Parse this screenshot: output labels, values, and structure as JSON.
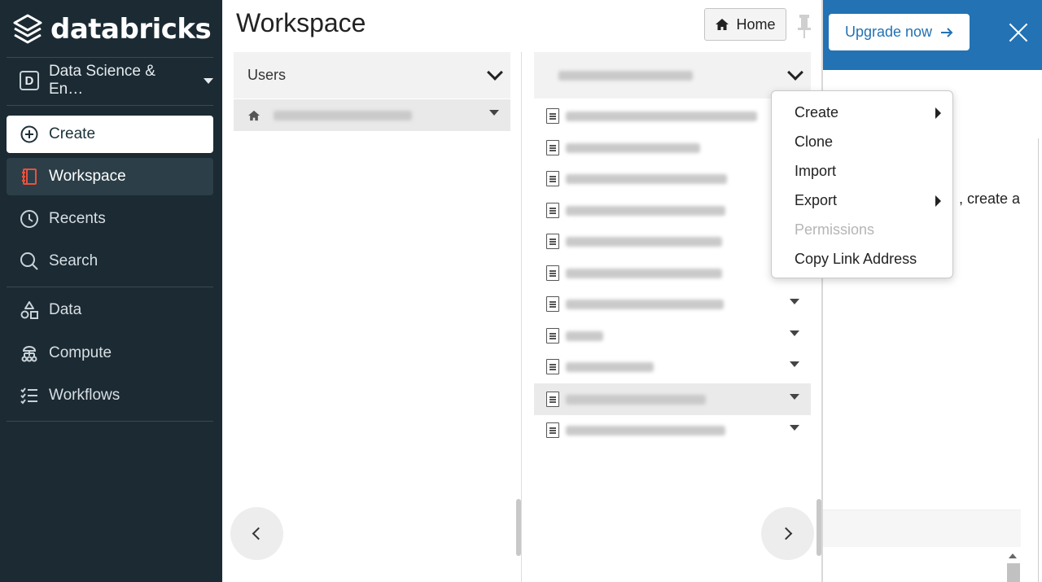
{
  "brand": {
    "name": "databricks"
  },
  "sidebar": {
    "persona": {
      "badge": "D",
      "label": "Data Science & En…"
    },
    "items": [
      {
        "label": "Create",
        "icon": "plus-circle-icon"
      },
      {
        "label": "Workspace",
        "icon": "workspace-icon"
      },
      {
        "label": "Recents",
        "icon": "clock-icon"
      },
      {
        "label": "Search",
        "icon": "search-icon"
      },
      {
        "label": "Data",
        "icon": "data-icon"
      },
      {
        "label": "Compute",
        "icon": "compute-icon"
      },
      {
        "label": "Workflows",
        "icon": "workflows-icon"
      }
    ]
  },
  "workspace": {
    "title": "Workspace",
    "home_label": "Home",
    "left_column": {
      "header": "Users"
    }
  },
  "context_menu": {
    "items": [
      {
        "label": "Create",
        "has_submenu": true,
        "disabled": false
      },
      {
        "label": "Clone",
        "has_submenu": false,
        "disabled": false
      },
      {
        "label": "Import",
        "has_submenu": false,
        "disabled": false
      },
      {
        "label": "Export",
        "has_submenu": true,
        "disabled": false
      },
      {
        "label": "Permissions",
        "has_submenu": false,
        "disabled": true
      },
      {
        "label": "Copy Link Address",
        "has_submenu": false,
        "disabled": false
      }
    ]
  },
  "background_page": {
    "upgrade_label": "Upgrade now",
    "partial_text": ", create a"
  },
  "colors": {
    "sidebar_bg": "#1b2a33",
    "accent_blue": "#2272b4",
    "workspace_icon_red": "#e8523f"
  }
}
